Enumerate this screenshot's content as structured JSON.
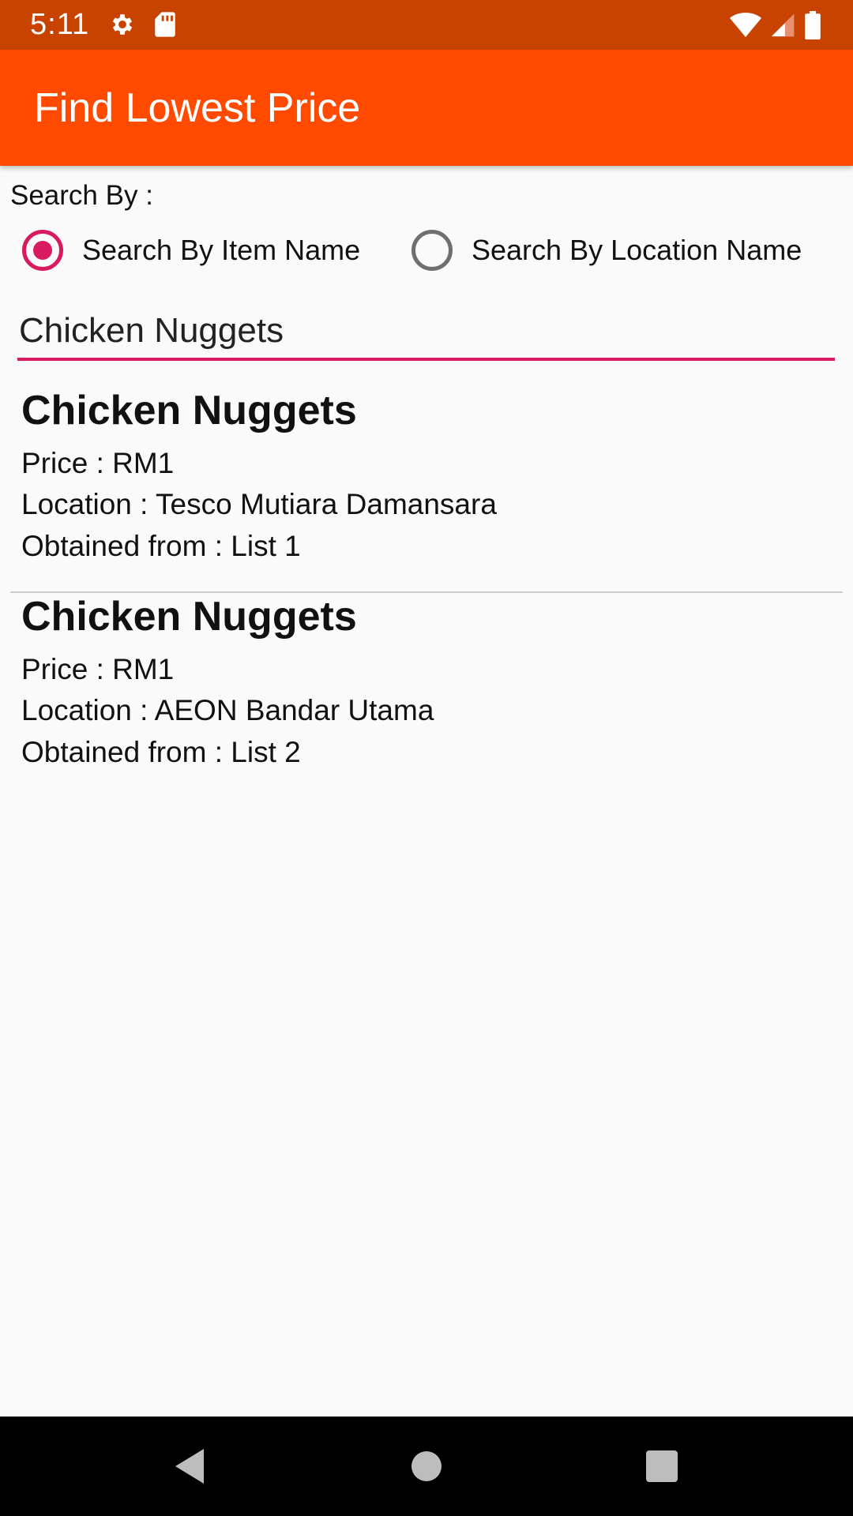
{
  "status_bar": {
    "time": "5:11",
    "left_icons": [
      "gear-icon",
      "sd-card-icon"
    ],
    "right_icons": [
      "wifi-icon",
      "signal-icon",
      "battery-icon"
    ]
  },
  "app_bar": {
    "title": "Find Lowest Price"
  },
  "search": {
    "label": "Search By :",
    "options": [
      {
        "label": "Search By Item Name",
        "checked": true
      },
      {
        "label": "Search By Location Name",
        "checked": false
      }
    ],
    "query": "Chicken Nuggets"
  },
  "results": [
    {
      "name": "Chicken Nuggets",
      "price": "Price : RM1",
      "location": "Location : Tesco Mutiara Damansara",
      "source": "Obtained from : List 1"
    },
    {
      "name": "Chicken Nuggets",
      "price": "Price : RM1",
      "location": "Location : AEON Bandar Utama",
      "source": "Obtained from : List 2"
    }
  ],
  "nav_bar": {
    "buttons": [
      "back-icon",
      "home-icon",
      "recents-icon"
    ]
  },
  "colors": {
    "status": "#c84200",
    "app_bar": "#ff4a00",
    "accent": "#d81b60"
  }
}
